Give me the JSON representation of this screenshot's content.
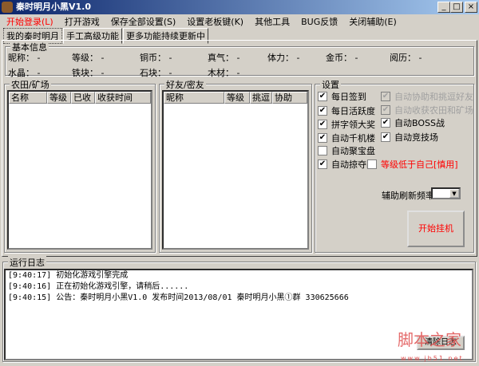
{
  "window": {
    "title": "秦时明月小黑V1.0",
    "min": "_",
    "max": "□",
    "close": "×"
  },
  "menu": [
    "开始登录(L)",
    "打开游戏",
    "保存全部设置(S)",
    "设置老板键(K)",
    "其他工具",
    "BUG反馈",
    "关闭辅助(E)"
  ],
  "tabs": [
    "我的秦时明月",
    "手工高级功能",
    "更多功能持续更新中"
  ],
  "basic_info": {
    "title": "基本信息",
    "fields": [
      {
        "label": "昵称：",
        "value": "-"
      },
      {
        "label": "等级：",
        "value": "-"
      },
      {
        "label": "铜币：",
        "value": "-"
      },
      {
        "label": "真气：",
        "value": "-"
      },
      {
        "label": "体力：",
        "value": "-"
      },
      {
        "label": "金币：",
        "value": "-"
      },
      {
        "label": "阅历：",
        "value": "-"
      },
      {
        "label": "水晶：",
        "value": "-"
      },
      {
        "label": "铁块：",
        "value": "-"
      },
      {
        "label": "石块：",
        "value": "-"
      },
      {
        "label": "木材：",
        "value": "-"
      }
    ]
  },
  "farm": {
    "title": "农田/矿场",
    "columns": [
      "名称",
      "等级",
      "已收",
      "收获时间"
    ]
  },
  "friends": {
    "title": "好友/密友",
    "columns": [
      "昵称",
      "等级",
      "挑逗",
      "协助"
    ]
  },
  "settings": {
    "title": "设置",
    "items": [
      {
        "label": "每日签到",
        "checked": true,
        "disabled": false
      },
      {
        "label": "每日活跃度",
        "checked": true,
        "disabled": false
      },
      {
        "label": "拼字领大奖",
        "checked": true,
        "disabled": false
      },
      {
        "label": "自动千机楼",
        "checked": true,
        "disabled": false
      },
      {
        "label": "自动聚宝盘",
        "checked": false,
        "disabled": false
      },
      {
        "label": "自动掠夺战",
        "checked": true,
        "disabled": false
      },
      {
        "label": "自动协助和挑逗好友",
        "checked": true,
        "disabled": true
      },
      {
        "label": "自动收获农田和矿场",
        "checked": true,
        "disabled": true
      },
      {
        "label": "自动BOSS战",
        "checked": true,
        "disabled": false
      },
      {
        "label": "自动竞技场",
        "checked": true,
        "disabled": false
      },
      {
        "label": "等级低于自己[慎用]",
        "checked": false,
        "disabled": false
      }
    ],
    "refresh_label": "辅助刷新频率：",
    "refresh_value": "",
    "start_button": "开始挂机"
  },
  "log": {
    "title": "运行日志",
    "lines": [
      "[9:40:17] 初始化游戏引擎完成",
      "[9:40:16] 正在初始化游戏引擎，请稍后......",
      "[9:40:15] 公告：秦时明月小黑V1.0 发布时间2013/08/01 秦时明月小黑①群  330625666"
    ],
    "clear_button": "清除日志"
  },
  "watermark": {
    "text": "脚本之家",
    "url": "www.jb51.net"
  }
}
